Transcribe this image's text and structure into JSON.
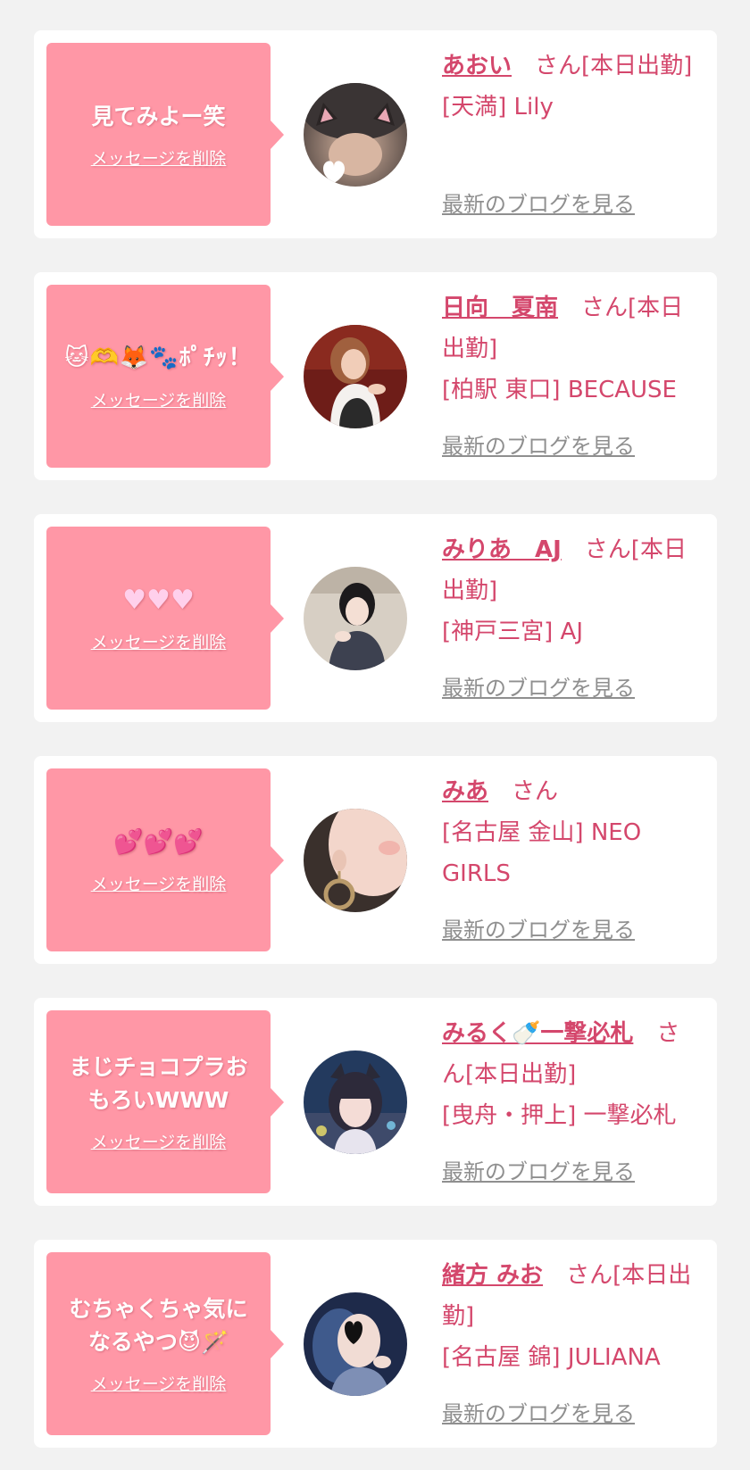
{
  "cards": [
    {
      "message": "見てみよー笑",
      "delete_label": "メッセージを削除",
      "name": "あおい",
      "suffix": "　さん[本日出勤]",
      "shop": "[天満] Lily",
      "blog_label": "最新のブログを見る"
    },
    {
      "message": "🐱🫶🦊🐾ﾎﾟﾁｯ！",
      "delete_label": "メッセージを削除",
      "name": "日向　夏南",
      "suffix": "　さん[本日出勤]",
      "shop": "[柏駅 東口] BECAUSE",
      "blog_label": "最新のブログを見る"
    },
    {
      "message": "♥♥♥",
      "delete_label": "メッセージを削除",
      "name": "みりあ　AJ",
      "suffix": "　さん[本日出勤]",
      "shop": "[神戸三宮] AJ",
      "blog_label": "最新のブログを見る"
    },
    {
      "message": "💕💕💕",
      "delete_label": "メッセージを削除",
      "name": "みあ",
      "suffix": "　さん",
      "shop": "[名古屋 金山] NEO GIRLS",
      "blog_label": "最新のブログを見る"
    },
    {
      "message": "まじチョコプラおもろいWWW",
      "delete_label": "メッセージを削除",
      "name": "みるく🍼一撃必札",
      "suffix": "　さん[本日出勤]",
      "shop": "[曳舟・押上] 一撃必札",
      "blog_label": "最新のブログを見る"
    },
    {
      "message": "むちゃくちゃ気になるやつ😈🪄",
      "delete_label": "メッセージを削除",
      "name": "緒方 みお",
      "suffix": "　さん[本日出勤]",
      "shop": "[名古屋 錦] JULIANA",
      "blog_label": "最新のブログを見る"
    }
  ]
}
